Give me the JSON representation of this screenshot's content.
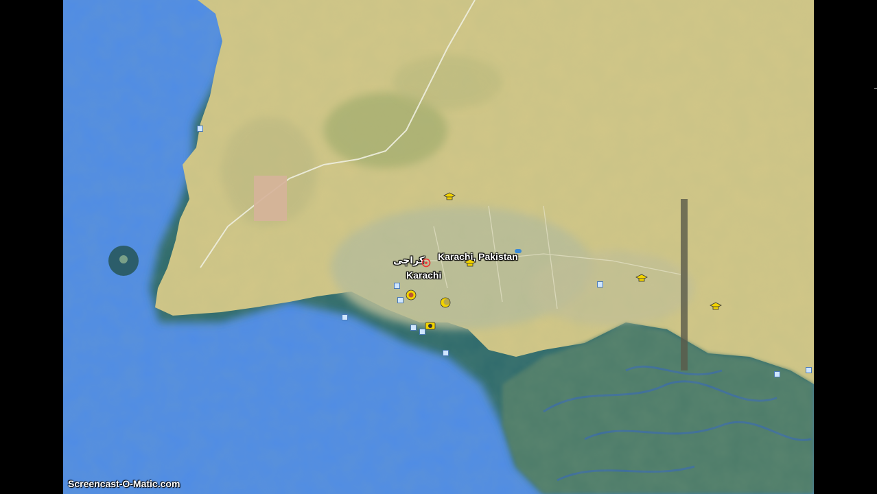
{
  "map": {
    "type": "satellite",
    "labels": {
      "place_main": "Karachi, Pakistan",
      "place_urdu": "کراچی",
      "place_city": "Karachi"
    },
    "colors": {
      "sea": "#4f8ce6",
      "land": "#d1c687",
      "urban": "#b9bd9a",
      "mangrove": "#4e7c6a",
      "marker": "#f2d300"
    },
    "icons": {
      "place": "target-icon",
      "university": "graduation-cap-icon",
      "religious": "crescent-icon",
      "photo": "camera-icon",
      "poi": "small-square-icon"
    }
  },
  "watermark": "Screencast-O-Matic.com"
}
